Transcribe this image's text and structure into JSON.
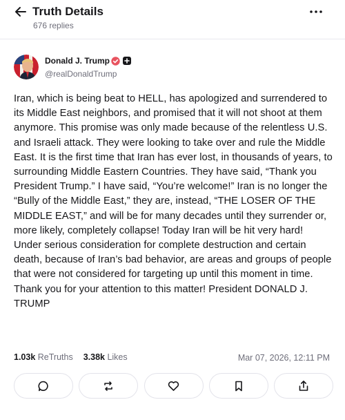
{
  "header": {
    "title": "Truth Details",
    "replies": "676 replies"
  },
  "post": {
    "author_name": "Donald J. Trump",
    "handle": "@realDonaldTrump",
    "body": "Iran, which is being beat to HELL, has apologized and surrendered to its Middle East neighbors, and promised that it will not shoot at them anymore. This promise was only made because of the relentless U.S. and Israeli attack. They were looking to take over and rule the Middle East. It is the first time that Iran has ever lost, in thousands of years, to surrounding Middle Eastern Countries. They have said, “Thank you President Trump.” I have said, “You’re welcome!” Iran is no longer the “Bully of the Middle East,” they are, instead, “THE LOSER OF THE MIDDLE EAST,” and will be for many decades until they surrender or, more likely, completely collapse! Today Iran will be hit very hard! Under serious consideration for complete destruction and certain death, because of Iran’s bad behavior, are areas and groups of people that were not considered for targeting up until this moment in time. Thank you for your attention to this matter! President DONALD J. TRUMP",
    "retruths_count": "1.03k",
    "retruths_label": "ReTruths",
    "likes_count": "3.38k",
    "likes_label": "Likes",
    "timestamp": "Mar 07, 2026, 12:11 PM"
  },
  "icons": {
    "back": "arrow-left-icon",
    "more": "more-dots-icon",
    "verified": "verified-badge-icon",
    "plus": "plus-badge-icon",
    "reply": "reply-bubble-icon",
    "retruth": "retruth-icon",
    "like": "heart-icon",
    "bookmark": "bookmark-icon",
    "share": "share-icon"
  },
  "colors": {
    "text": "#17171a",
    "muted": "#6e6e7a",
    "verified": "#e8535f",
    "border": "#e3e3ea"
  }
}
